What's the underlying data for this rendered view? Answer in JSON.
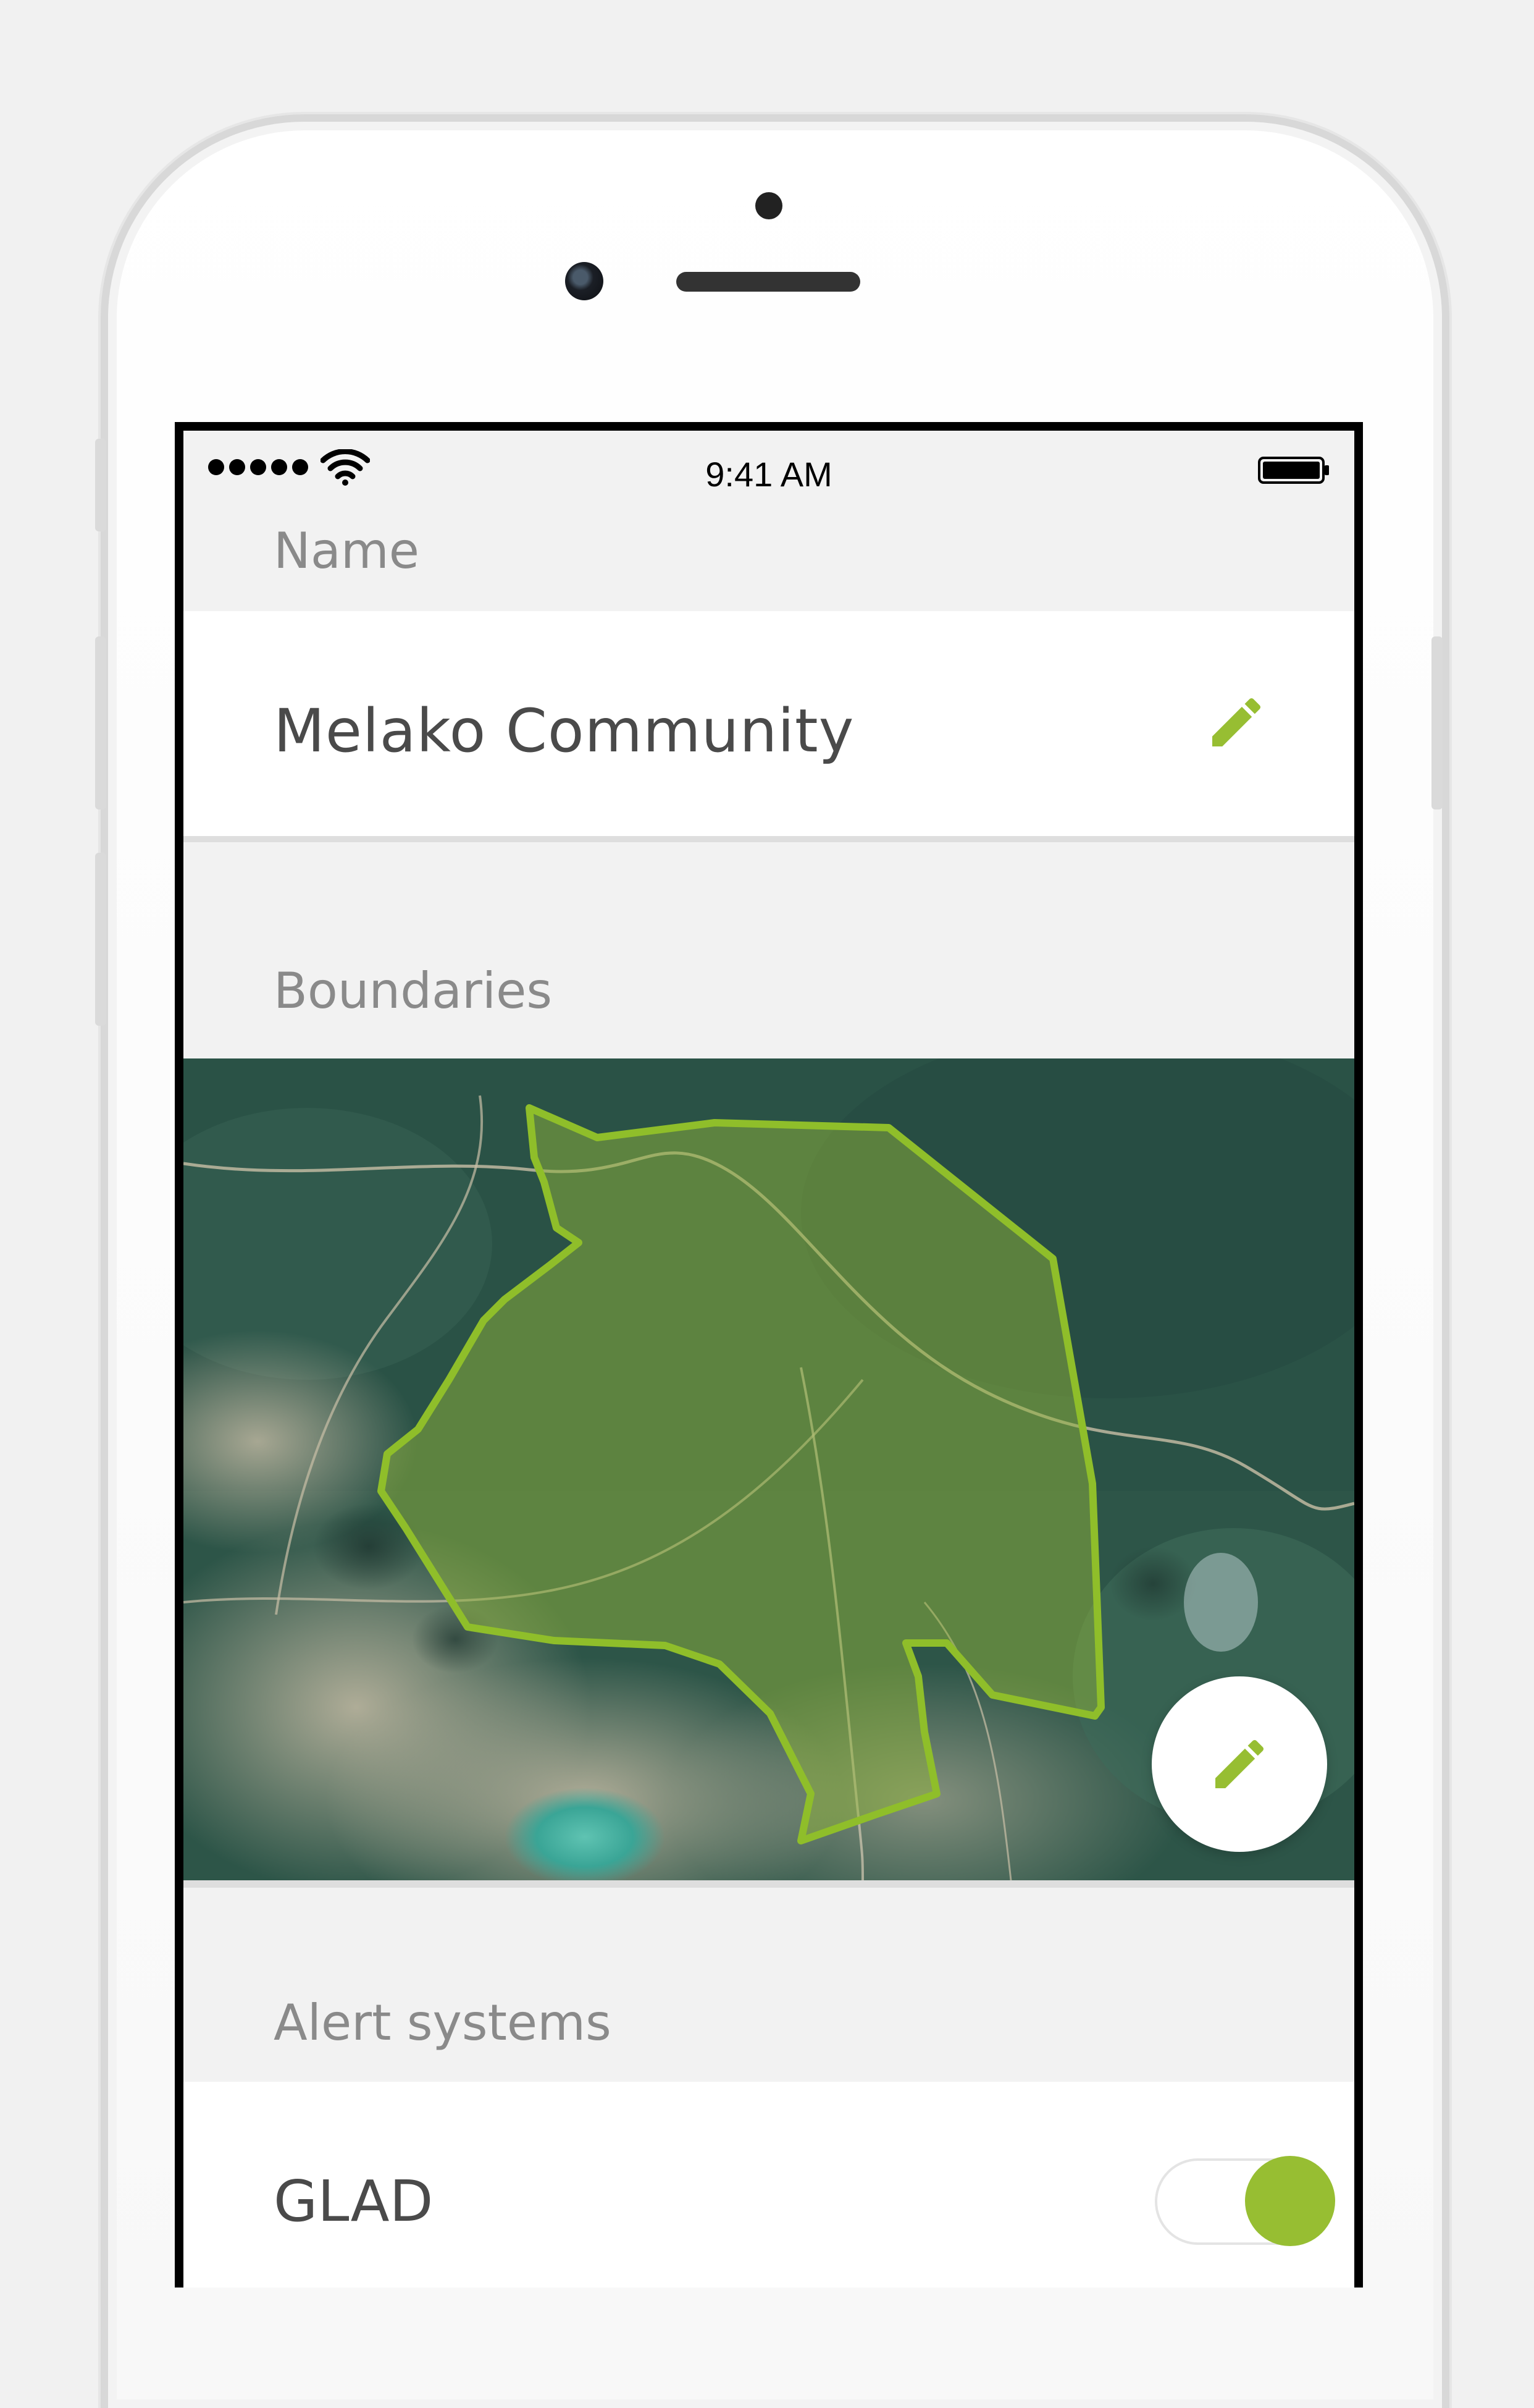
{
  "status_bar": {
    "time": "9:41 AM",
    "signal_icon": "signal-dots-icon",
    "wifi_icon": "wifi-icon",
    "battery_icon": "battery-icon"
  },
  "name_section": {
    "label": "Name",
    "value": "Melako Community",
    "edit_icon": "pencil-icon"
  },
  "boundaries_section": {
    "label": "Boundaries",
    "map_image": "satellite-map",
    "edit_icon": "pencil-icon"
  },
  "alerts_section": {
    "label": "Alert systems",
    "items": [
      {
        "label": "GLAD",
        "enabled": true
      }
    ]
  },
  "colors": {
    "accent": "#97be32",
    "background": "#f2f2f2",
    "card": "#ffffff",
    "label": "#8a8a8a",
    "text": "#4a4a4a"
  }
}
